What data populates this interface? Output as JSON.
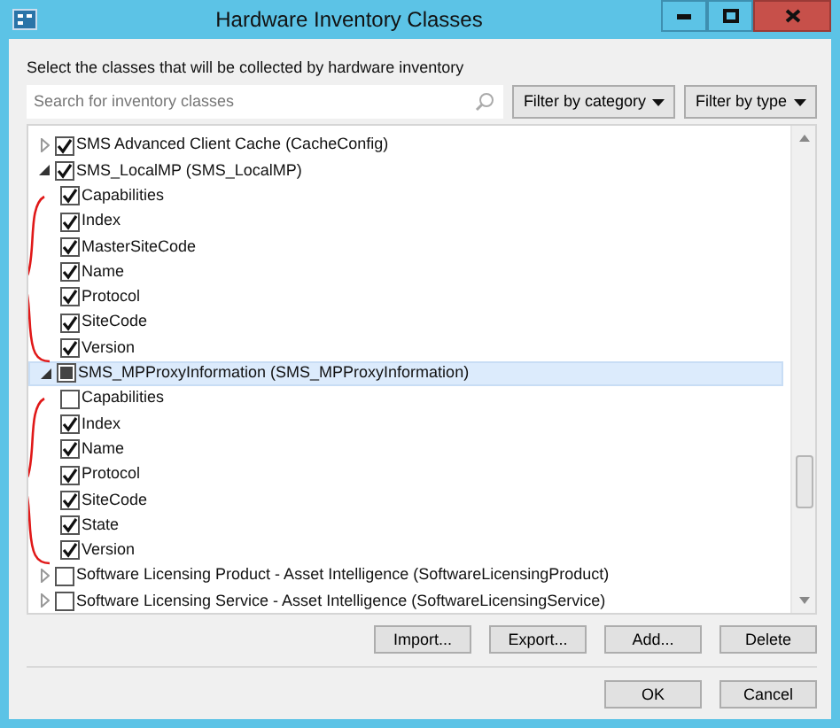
{
  "window": {
    "title": "Hardware Inventory Classes"
  },
  "instruction": "Select the classes that will be collected by hardware inventory",
  "search": {
    "placeholder": "Search for inventory classes"
  },
  "filters": [
    {
      "label": "Filter by category"
    },
    {
      "label": "Filter by type"
    }
  ],
  "classes": [
    {
      "label": "SMS Advanced Client Cache (CacheConfig)",
      "checked": true,
      "indeterminate": false,
      "selected": false,
      "expanded": false,
      "annotated": false
    },
    {
      "label": "SMS_LocalMP (SMS_LocalMP)",
      "checked": true,
      "indeterminate": false,
      "selected": false,
      "expanded": true,
      "annotated": true,
      "children": [
        {
          "label": "Capabilities",
          "checked": true
        },
        {
          "label": "Index",
          "checked": true
        },
        {
          "label": "MasterSiteCode",
          "checked": true
        },
        {
          "label": "Name",
          "checked": true
        },
        {
          "label": "Protocol",
          "checked": true
        },
        {
          "label": "SiteCode",
          "checked": true
        },
        {
          "label": "Version",
          "checked": true
        }
      ]
    },
    {
      "label": "SMS_MPProxyInformation (SMS_MPProxyInformation)",
      "checked": false,
      "indeterminate": true,
      "selected": true,
      "expanded": true,
      "annotated": true,
      "children": [
        {
          "label": "Capabilities",
          "checked": false
        },
        {
          "label": "Index",
          "checked": true
        },
        {
          "label": "Name",
          "checked": true
        },
        {
          "label": "Protocol",
          "checked": true
        },
        {
          "label": "SiteCode",
          "checked": true
        },
        {
          "label": "State",
          "checked": true
        },
        {
          "label": "Version",
          "checked": true
        }
      ]
    },
    {
      "label": "Software Licensing Product - Asset Intelligence (SoftwareLicensingProduct)",
      "checked": false,
      "indeterminate": false,
      "selected": false,
      "expanded": false,
      "annotated": false
    },
    {
      "label": "Software Licensing Service - Asset Intelligence (SoftwareLicensingService)",
      "checked": false,
      "indeterminate": false,
      "selected": false,
      "expanded": false,
      "annotated": false
    }
  ],
  "actions": [
    "Import...",
    "Export...",
    "Add...",
    "Delete"
  ],
  "dialog_buttons": [
    "OK",
    "Cancel"
  ]
}
